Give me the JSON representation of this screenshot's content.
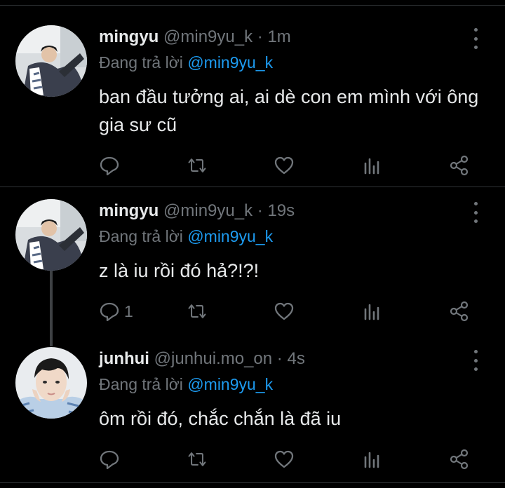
{
  "tweets": [
    {
      "name": "mingyu",
      "handle": "@min9yu_k",
      "dot": "·",
      "time": "1m",
      "reply_prefix": "Đang trả lời",
      "reply_to": "@min9yu_k",
      "text": "ban đầu tưởng ai, ai dè con em mình với ông gia sư cũ",
      "reply_count": ""
    },
    {
      "name": "mingyu",
      "handle": "@min9yu_k",
      "dot": "·",
      "time": "19s",
      "reply_prefix": "Đang trả lời",
      "reply_to": "@min9yu_k",
      "text": "z là iu rồi đó hả?!?!",
      "reply_count": "1"
    },
    {
      "name": "junhui",
      "handle": "@junhui.mo_on",
      "dot": "·",
      "time": "4s",
      "reply_prefix": "Đang trả lời",
      "reply_to": "@min9yu_k",
      "text": "ôm rồi đó, chắc chắn là đã iu",
      "reply_count": ""
    }
  ],
  "icons": {
    "reply": "reply-icon",
    "retweet": "retweet-icon",
    "like": "heart-icon",
    "views": "views-icon",
    "share": "share-icon",
    "more": "more-vertical-icon"
  },
  "colors": {
    "background": "#000000",
    "text": "#e7e9ea",
    "muted": "#71767b",
    "link": "#1d9bf0",
    "divider": "#2f3336"
  }
}
